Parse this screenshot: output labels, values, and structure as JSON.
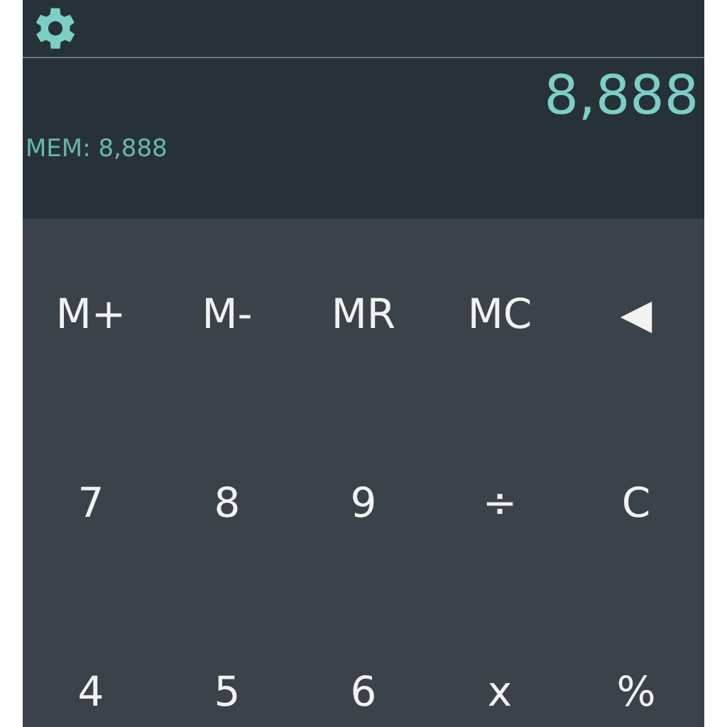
{
  "display": {
    "value": "8,888",
    "memory": "MEM: 8,888"
  },
  "keys": [
    [
      "M+",
      "M-",
      "MR",
      "MC",
      "◀"
    ],
    [
      "7",
      "8",
      "9",
      "÷",
      "C"
    ],
    [
      "4",
      "5",
      "6",
      "x",
      "%"
    ]
  ]
}
